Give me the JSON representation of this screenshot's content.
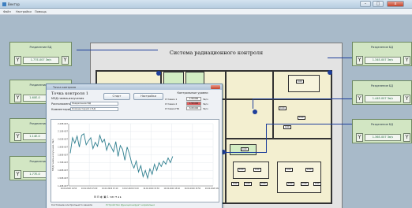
{
  "window": {
    "title": "Вектор",
    "min": "–",
    "max": "□",
    "close": "x"
  },
  "menu": [
    "Файл",
    "Настройки",
    "Помощь"
  ],
  "plan": {
    "title": "Система радиационного контроля"
  },
  "sensors_left": [
    {
      "title": "Разделение БД",
      "value": "1.77Е-007 Зв/ч"
    },
    {
      "title": "Разделение БД",
      "value": "1.60Е-0"
    },
    {
      "title": "Разделение БД",
      "value": "1.14Е-0"
    },
    {
      "title": "Разделение БД",
      "value": "1.77Е-0"
    }
  ],
  "sensors_right": [
    {
      "title": "Разделение БД",
      "value": "1.34Е-007 Зв/ч"
    },
    {
      "title": "Разделение БД",
      "value": "1.44Е-007 Зв/ч"
    },
    {
      "title": "Разделение БД",
      "value": "1.36Е-007 Зв/ч"
    }
  ],
  "room_labels": [
    "0.00",
    "0.00",
    "0.00",
    "0.00",
    "0.00",
    "0.00",
    "0.00",
    "0.00",
    "0.00",
    "0.00",
    "0.00",
    "0.00",
    "0.00",
    "0.00",
    "0.00"
  ],
  "popup": {
    "title": "Точка контроля",
    "control_point": "Точка контроля 1",
    "fields": [
      {
        "label": "МЭД гамма-излучения",
        "value": ""
      },
      {
        "label": "Расположение",
        "value": "Разделение БД"
      },
      {
        "label": "Комментарий",
        "value": "Комментарий к БД"
      }
    ],
    "start_label": "Старт",
    "settings_label": "Настройки",
    "thresholds": {
      "title": "Контрольные уровни",
      "rows": [
        {
          "name": "Уставка 1",
          "value": "1.5Е-006",
          "unit": "Зв/ч",
          "color": "#f6f6f6"
        },
        {
          "name": "Уставка 2",
          "value": "1.5Е-006",
          "unit": "Зв/ч",
          "color": "#e05a5a"
        },
        {
          "name": "Уставка ПБ",
          "value": "8.0Е-006",
          "unit": "Зв/ч",
          "color": "#f6f6f6"
        }
      ]
    },
    "toolbar": "⊞ ⊟ ◐ ▣ 1 час ▾ ◂ ▸",
    "footer_label": "Состояние контрольного канала",
    "footer_value": "Устройство функционирует нормально"
  },
  "chart_data": {
    "type": "line",
    "title": "",
    "ylabel": "МЭД гамма-излучения, Зв/ч",
    "xlabel": "",
    "ylim": [
      1.4e-07,
      2.2e-07
    ],
    "y_ticks": [
      "2.20E-007",
      "2.10E-007",
      "2.00E-007",
      "1.90E-007",
      "1.80E-007",
      "1.70E-007",
      "1.60E-007",
      "1.50E-007",
      "1.40E-007"
    ],
    "x_ticks": [
      "10.02.2020 14:50",
      "10.02.2020 15:00",
      "10.02.2020 15:10",
      "10.02.2020 15:20",
      "10.02.2020 15:30",
      "10.02.2020 15:40",
      "10.02.2020 15:50",
      "10.02.2020 16:00"
    ],
    "series": [
      {
        "color": "#2f7f8f",
        "values": [
          1.82e-07,
          2.02e-07,
          1.95e-07,
          2.04e-07,
          1.9e-07,
          2.05e-07,
          2.07e-07,
          1.93e-07,
          1.98e-07,
          2.02e-07,
          1.88e-07,
          1.96e-07,
          1.91e-07,
          2.05e-07,
          1.96e-07,
          2e-07,
          1.86e-07,
          1.95e-07,
          1.9e-07,
          1.84e-07,
          1.97e-07,
          1.78e-07,
          1.92e-07,
          1.87e-07,
          1.73e-07,
          1.9e-07,
          1.81e-07,
          1.69e-07,
          1.63e-07,
          1.72e-07,
          1.58e-07,
          1.66e-07,
          1.52e-07,
          1.6e-07,
          1.5e-07,
          1.62e-07,
          1.55e-07,
          1.68e-07,
          1.6e-07,
          1.7e-07,
          1.65e-07,
          1.72e-07,
          1.68e-07,
          1.76e-07,
          1.7e-07,
          1.78e-07
        ]
      }
    ]
  }
}
